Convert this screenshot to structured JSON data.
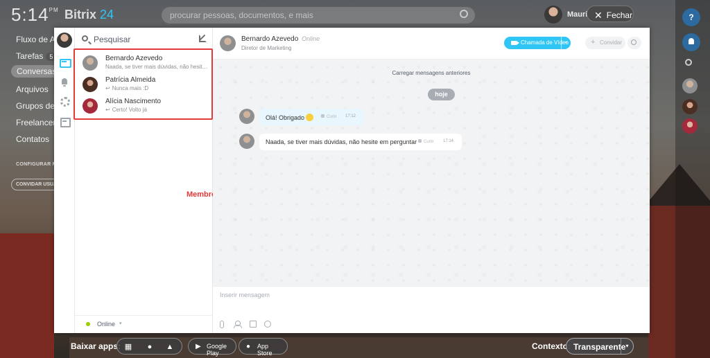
{
  "portal": {
    "clock": "5:14",
    "clock_ampm": "PM",
    "brand_name": "Bitrix",
    "brand_number": "24",
    "search_placeholder": "procurar pessoas, documentos, e mais",
    "user_name": "Mauricio",
    "close_label": "Fechar",
    "left_menu": [
      "Fluxo de At",
      "Tarefas",
      "Conversas",
      "Arquivos",
      "Grupos de T",
      "Freelancers",
      "Contatos"
    ],
    "tasks_badge": "5",
    "configure_menu": "CONFIGURAR ME",
    "invite_users": "CONVIDAR USUÁ",
    "help_label": "?"
  },
  "bottom_bar": {
    "download_label": "Baixar apps:",
    "google_play": "Google Play",
    "app_store": "App Store",
    "context_label": "Contexto:",
    "context_value": "Transparente"
  },
  "messenger": {
    "search_placeholder": "Pesquisar",
    "contacts": [
      {
        "name": "Bernardo Azevedo",
        "last_message": "Naada, se tiver mais dúvidas, não hesite em perguntar",
        "reply": false
      },
      {
        "name": "Patrícia Almeida",
        "last_message": "Nunca mais :D",
        "reply": true
      },
      {
        "name": "Alícia Nascimento",
        "last_message": "Certo! Volto já",
        "reply": true
      }
    ],
    "annotation": "Membros do grupo Extranet",
    "status": "Online",
    "chat": {
      "contact_name": "Bernardo Azevedo",
      "contact_status": "Online",
      "contact_role": "Diretor de Marketing",
      "video_button": "Chamada de Vídeo",
      "invite_button": "Convidar",
      "load_more": "Carregar mensagens anteriores",
      "date_label": "hoje",
      "messages": [
        {
          "text": "Olá! Obrigado",
          "like_label": "Curtir",
          "time": "17:12"
        },
        {
          "text": "Naada, se tiver mais dúvidas, não hesite em perguntar",
          "like_label": "Curtir",
          "time": "17:14"
        }
      ],
      "input_placeholder": "Inserir mensagem"
    }
  },
  "colors": {
    "accent": "#2fc6f6",
    "annotation_red": "#e23939",
    "online_green": "#9dcf00"
  }
}
